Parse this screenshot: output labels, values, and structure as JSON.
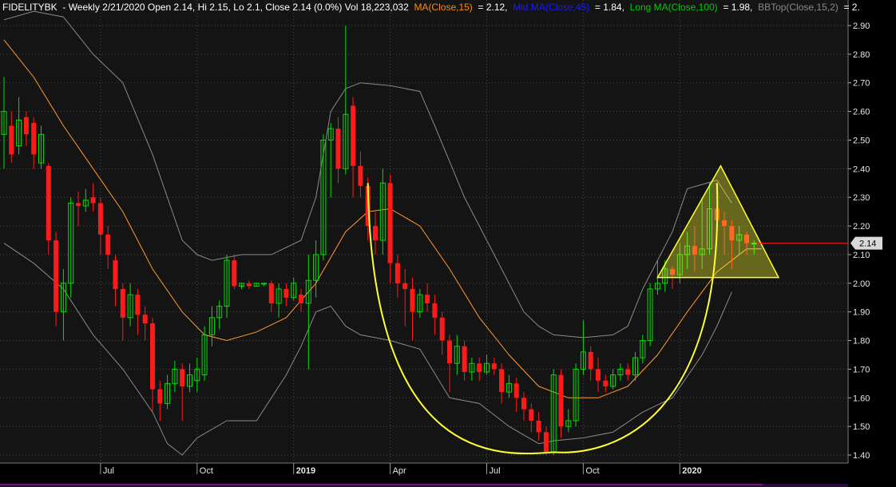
{
  "header": {
    "symbol": "FIDELITYBK",
    "info": " - Weekly 2/21/2020 Open 2.14, Hi 2.15, Lo 2.1, Close 2.14 (0.0%) Vol 18,223,032 ",
    "ma15_label": "MA(Close,15)",
    "ma15_value": " = 2.12, ",
    "mid_label": "Mid MA(Close,45)",
    "mid_value": " = 1.84, ",
    "long_label": "Long MA(Close,100)",
    "long_value": " = 1.98, ",
    "bb_label": "BBTop(Close,15,2)",
    "bb_value": " = 2."
  },
  "colors": {
    "background": "#141414",
    "up": "#00e000",
    "down": "#ff1a1a",
    "ma15": "#ff9933",
    "bb": "#8a8a8a",
    "pattern": "#ffff33",
    "grid": "#4a4a4a",
    "mid_label": "#1a1aff",
    "long_label": "#00cc00",
    "ma15_label": "#ff8c00",
    "bb_label": "#888888"
  },
  "chart_data": {
    "type": "candlestick",
    "y_axis": {
      "min": 1.4,
      "max": 2.9,
      "ticks": [
        "2.90",
        "2.80",
        "2.70",
        "2.60",
        "2.50",
        "2.40",
        "2.30",
        "2.20",
        "2.10",
        "2.00",
        "1.90",
        "1.80",
        "1.70",
        "1.60",
        "1.50",
        "1.40"
      ]
    },
    "time_labels": [
      {
        "label": "Jul",
        "index": 13,
        "bold": false
      },
      {
        "label": "Oct",
        "index": 26,
        "bold": false
      },
      {
        "label": "2019",
        "index": 39,
        "bold": true
      },
      {
        "label": "Apr",
        "index": 52,
        "bold": false
      },
      {
        "label": "Jul",
        "index": 65,
        "bold": false
      },
      {
        "label": "Oct",
        "index": 78,
        "bold": false
      },
      {
        "label": "2020",
        "index": 91,
        "bold": true
      }
    ],
    "last_price": "2.14",
    "candles": [
      [
        2.52,
        2.6,
        2.72,
        2.4
      ],
      [
        2.55,
        2.45,
        2.6,
        2.42
      ],
      [
        2.48,
        2.57,
        2.65,
        2.45
      ],
      [
        2.58,
        2.52,
        2.6,
        2.48
      ],
      [
        2.56,
        2.45,
        2.58,
        2.4
      ],
      [
        2.42,
        2.52,
        2.55,
        2.4
      ],
      [
        2.41,
        2.15,
        2.42,
        2.1
      ],
      [
        2.15,
        1.9,
        2.18,
        1.85
      ],
      [
        1.9,
        2.0,
        2.05,
        1.8
      ],
      [
        2.0,
        2.28,
        2.3,
        1.95
      ],
      [
        2.28,
        2.27,
        2.32,
        2.2
      ],
      [
        2.27,
        2.29,
        2.33,
        2.25
      ],
      [
        2.3,
        2.28,
        2.35,
        2.25
      ],
      [
        2.28,
        2.17,
        2.3,
        2.1
      ],
      [
        2.17,
        2.1,
        2.2,
        2.05
      ],
      [
        2.08,
        1.98,
        2.1,
        1.92
      ],
      [
        1.98,
        1.88,
        2.0,
        1.8
      ],
      [
        1.88,
        1.96,
        2.0,
        1.85
      ],
      [
        1.96,
        1.89,
        1.98,
        1.82
      ],
      [
        1.89,
        1.86,
        1.92,
        1.8
      ],
      [
        1.86,
        1.63,
        1.88,
        1.55
      ],
      [
        1.63,
        1.58,
        1.66,
        1.52
      ],
      [
        1.58,
        1.65,
        1.68,
        1.56
      ],
      [
        1.65,
        1.7,
        1.73,
        1.62
      ],
      [
        1.7,
        1.64,
        1.72,
        1.52
      ],
      [
        1.64,
        1.68,
        1.72,
        1.62
      ],
      [
        1.66,
        1.7,
        1.74,
        1.62
      ],
      [
        1.68,
        1.82,
        1.85,
        1.66
      ],
      [
        1.82,
        1.88,
        1.92,
        1.78
      ],
      [
        1.88,
        1.92,
        1.94,
        1.84
      ],
      [
        1.92,
        2.08,
        2.1,
        1.88
      ],
      [
        2.08,
        1.99,
        2.1,
        1.98
      ],
      [
        1.99,
        2.0,
        2.0,
        1.98
      ],
      [
        2.0,
        1.99,
        2.01,
        1.98
      ],
      [
        1.99,
        2.0,
        2.0,
        1.99
      ],
      [
        2.0,
        2.0,
        2.0,
        1.99
      ],
      [
        2.0,
        1.93,
        2.01,
        1.9
      ],
      [
        1.93,
        1.98,
        2.0,
        1.88
      ],
      [
        1.98,
        1.95,
        2.0,
        1.92
      ],
      [
        1.95,
        2.0,
        2.02,
        1.94
      ],
      [
        1.96,
        1.93,
        1.98,
        1.9
      ],
      [
        1.93,
        2.01,
        2.1,
        1.7
      ],
      [
        2.01,
        2.1,
        2.15,
        1.95
      ],
      [
        2.1,
        2.5,
        2.52,
        2.08
      ],
      [
        2.5,
        2.54,
        2.56,
        2.3
      ],
      [
        2.54,
        2.4,
        2.58,
        2.35
      ],
      [
        2.4,
        2.59,
        2.9,
        2.38
      ],
      [
        2.62,
        2.41,
        2.65,
        2.3
      ],
      [
        2.41,
        2.34,
        2.46,
        2.3
      ],
      [
        2.34,
        2.2,
        2.37,
        2.15
      ],
      [
        2.2,
        2.15,
        2.25,
        2.1
      ],
      [
        2.15,
        2.35,
        2.4,
        2.1
      ],
      [
        2.35,
        2.07,
        2.38,
        2.0
      ],
      [
        2.07,
        2.0,
        2.1,
        1.95
      ],
      [
        2.0,
        1.98,
        2.05,
        1.85
      ],
      [
        1.98,
        1.9,
        2.02,
        1.8
      ],
      [
        1.9,
        1.96,
        1.98,
        1.88
      ],
      [
        1.96,
        1.93,
        2.0,
        1.9
      ],
      [
        1.93,
        1.88,
        1.96,
        1.82
      ],
      [
        1.88,
        1.8,
        1.9,
        1.75
      ],
      [
        1.8,
        1.72,
        1.82,
        1.62
      ],
      [
        1.72,
        1.78,
        1.82,
        1.68
      ],
      [
        1.78,
        1.69,
        1.8,
        1.66
      ],
      [
        1.69,
        1.72,
        1.74,
        1.66
      ],
      [
        1.72,
        1.69,
        1.74,
        1.66
      ],
      [
        1.69,
        1.72,
        1.75,
        1.68
      ],
      [
        1.72,
        1.7,
        1.74,
        1.68
      ],
      [
        1.7,
        1.62,
        1.72,
        1.58
      ],
      [
        1.62,
        1.65,
        1.68,
        1.6
      ],
      [
        1.65,
        1.6,
        1.67,
        1.55
      ],
      [
        1.6,
        1.56,
        1.62,
        1.52
      ],
      [
        1.56,
        1.52,
        1.58,
        1.48
      ],
      [
        1.52,
        1.48,
        1.55,
        1.45
      ],
      [
        1.48,
        1.41,
        1.5,
        1.4
      ],
      [
        1.41,
        1.68,
        1.7,
        1.4
      ],
      [
        1.68,
        1.5,
        1.7,
        1.46
      ],
      [
        1.5,
        1.52,
        1.56,
        1.48
      ],
      [
        1.52,
        1.7,
        1.72,
        1.5
      ],
      [
        1.7,
        1.76,
        1.87,
        1.68
      ],
      [
        1.76,
        1.7,
        1.78,
        1.66
      ],
      [
        1.7,
        1.66,
        1.74,
        1.62
      ],
      [
        1.66,
        1.64,
        1.68,
        1.62
      ],
      [
        1.64,
        1.68,
        1.7,
        1.63
      ],
      [
        1.68,
        1.7,
        1.72,
        1.66
      ],
      [
        1.7,
        1.68,
        1.72,
        1.66
      ],
      [
        1.68,
        1.74,
        1.76,
        1.66
      ],
      [
        1.74,
        1.8,
        1.82,
        1.72
      ],
      [
        1.8,
        1.98,
        2.0,
        1.78
      ],
      [
        1.98,
        2.0,
        2.08,
        1.96
      ],
      [
        2.0,
        2.05,
        2.08,
        1.97
      ],
      [
        2.05,
        2.03,
        2.06,
        1.98
      ],
      [
        2.03,
        2.1,
        2.14,
        2.0
      ],
      [
        2.1,
        2.13,
        2.18,
        2.05
      ],
      [
        2.13,
        2.1,
        2.2,
        2.04
      ],
      [
        2.1,
        2.12,
        2.3,
        2.05
      ],
      [
        2.12,
        2.26,
        2.35,
        2.1
      ],
      [
        2.26,
        2.22,
        2.28,
        2.15
      ],
      [
        2.22,
        2.2,
        2.25,
        2.1
      ],
      [
        2.2,
        2.15,
        2.22,
        2.05
      ],
      [
        2.15,
        2.17,
        2.2,
        2.1
      ],
      [
        2.17,
        2.14,
        2.18,
        2.1
      ],
      [
        2.14,
        2.14,
        2.15,
        2.1
      ]
    ],
    "overlays": {
      "ma15": [
        [
          0,
          2.85
        ],
        [
          4,
          2.72
        ],
        [
          8,
          2.55
        ],
        [
          12,
          2.4
        ],
        [
          16,
          2.25
        ],
        [
          20,
          2.05
        ],
        [
          24,
          1.9
        ],
        [
          27,
          1.82
        ],
        [
          30,
          1.8
        ],
        [
          34,
          1.83
        ],
        [
          38,
          1.88
        ],
        [
          42,
          2.0
        ],
        [
          46,
          2.18
        ],
        [
          49,
          2.25
        ],
        [
          52,
          2.26
        ],
        [
          56,
          2.2
        ],
        [
          60,
          2.05
        ],
        [
          64,
          1.88
        ],
        [
          68,
          1.75
        ],
        [
          72,
          1.64
        ],
        [
          76,
          1.6
        ],
        [
          80,
          1.6
        ],
        [
          84,
          1.64
        ],
        [
          88,
          1.75
        ],
        [
          92,
          1.9
        ],
        [
          96,
          2.04
        ],
        [
          100,
          2.12
        ],
        [
          102,
          2.12
        ]
      ],
      "bb_upper": [
        [
          0,
          2.92
        ],
        [
          4,
          2.95
        ],
        [
          8,
          2.93
        ],
        [
          12,
          2.8
        ],
        [
          16,
          2.7
        ],
        [
          20,
          2.45
        ],
        [
          24,
          2.15
        ],
        [
          26,
          2.1
        ],
        [
          28,
          2.08
        ],
        [
          32,
          2.1
        ],
        [
          36,
          2.1
        ],
        [
          40,
          2.15
        ],
        [
          42,
          2.3
        ],
        [
          44,
          2.6
        ],
        [
          46,
          2.68
        ],
        [
          48,
          2.7
        ],
        [
          52,
          2.69
        ],
        [
          56,
          2.67
        ],
        [
          58,
          2.55
        ],
        [
          62,
          2.3
        ],
        [
          66,
          2.1
        ],
        [
          70,
          1.9
        ],
        [
          72,
          1.85
        ],
        [
          74,
          1.82
        ],
        [
          78,
          1.81
        ],
        [
          82,
          1.82
        ],
        [
          84,
          1.85
        ],
        [
          86,
          1.98
        ],
        [
          90,
          2.18
        ],
        [
          92,
          2.33
        ],
        [
          96,
          2.36
        ],
        [
          98,
          2.28
        ]
      ],
      "bb_lower": [
        [
          0,
          2.14
        ],
        [
          4,
          2.07
        ],
        [
          8,
          1.98
        ],
        [
          12,
          1.82
        ],
        [
          16,
          1.7
        ],
        [
          20,
          1.55
        ],
        [
          22,
          1.44
        ],
        [
          24,
          1.4
        ],
        [
          26,
          1.46
        ],
        [
          30,
          1.52
        ],
        [
          34,
          1.52
        ],
        [
          38,
          1.68
        ],
        [
          40,
          1.78
        ],
        [
          42,
          1.9
        ],
        [
          44,
          1.92
        ],
        [
          46,
          1.85
        ],
        [
          48,
          1.82
        ],
        [
          52,
          1.8
        ],
        [
          56,
          1.77
        ],
        [
          60,
          1.6
        ],
        [
          64,
          1.58
        ],
        [
          68,
          1.5
        ],
        [
          72,
          1.44
        ],
        [
          74,
          1.45
        ],
        [
          78,
          1.46
        ],
        [
          82,
          1.48
        ],
        [
          86,
          1.55
        ],
        [
          90,
          1.6
        ],
        [
          94,
          1.75
        ],
        [
          96,
          1.85
        ],
        [
          98,
          1.97
        ]
      ]
    }
  }
}
